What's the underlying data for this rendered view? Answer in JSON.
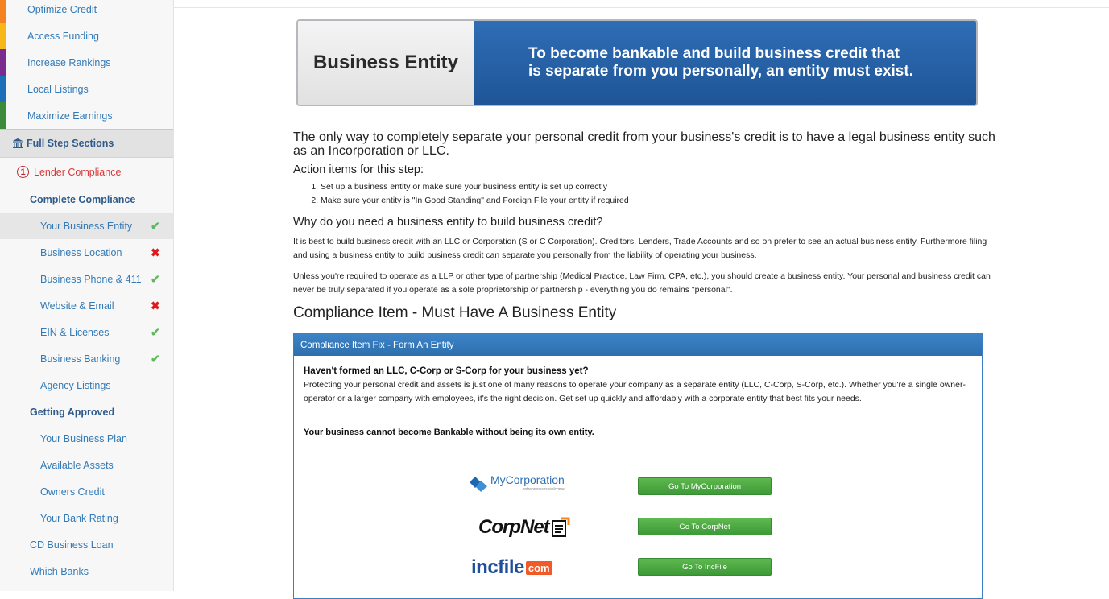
{
  "sidebar": {
    "top_items": [
      {
        "label": "Optimize Credit",
        "color": "#f58220"
      },
      {
        "label": "Access Funding",
        "color": "#f7b718"
      },
      {
        "label": "Increase Rankings",
        "color": "#7a2c8f"
      },
      {
        "label": "Local Listings",
        "color": "#1c6fb8"
      },
      {
        "label": "Maximize Earnings",
        "color": "#3b8b3b"
      }
    ],
    "section_title": "Full Step Sections",
    "lender": {
      "number": "1",
      "label": "Lender Compliance"
    },
    "complete_heading": "Complete Compliance",
    "complete_items": [
      {
        "label": "Your Business Entity",
        "status": "✔"
      },
      {
        "label": "Business Location",
        "status": "✖"
      },
      {
        "label": "Business Phone & 411",
        "status": "✔"
      },
      {
        "label": "Website & Email",
        "status": "✖"
      },
      {
        "label": "EIN & Licenses",
        "status": "✔"
      },
      {
        "label": "Business Banking",
        "status": "✔"
      },
      {
        "label": "Agency Listings"
      }
    ],
    "approved_heading": "Getting Approved",
    "approved_items": [
      {
        "label": "Your Business Plan"
      },
      {
        "label": "Available Assets"
      },
      {
        "label": "Owners Credit"
      },
      {
        "label": "Your Bank Rating"
      }
    ],
    "bottom_items": [
      {
        "label": "CD Business Loan"
      },
      {
        "label": "Which Banks"
      }
    ]
  },
  "banner": {
    "title": "Business Entity",
    "line1": "To become bankable and build business credit that",
    "line2": "is separate from you personally, an entity must exist."
  },
  "content": {
    "lead": "The only way to completely separate your personal credit from your business's credit is to have a legal business entity such as an Incorporation or LLC.",
    "action_heading": "Action items for this step:",
    "actions": [
      "Set up a business entity or make sure your business entity is set up correctly",
      "Make sure your entity is \"In Good Standing\" and Foreign File your entity if required"
    ],
    "why_heading": "Why do you need a business entity to build business credit?",
    "para1": "It is best to build business credit with an LLC or Corporation (S or C Corporation).  Creditors, Lenders, Trade Accounts and so on prefer to see an actual business entity. Furthermore filing and using a business entity to build business credit can separate you personally from the liability of operating your business.",
    "para2": "Unless you're required to operate as a LLP or other type of partnership (Medical Practice, Law Firm, CPA, etc.), you should create a business entity. Your personal and business credit can never be truly separated if you operate as a sole proprietorship or partnership - everything you do remains \"personal\".",
    "compliance_heading": "Compliance Item - Must Have A Business Entity"
  },
  "panel": {
    "header": "Compliance Item Fix - Form An Entity",
    "question": "Haven't formed an LLC, C-Corp or S-Corp for your business yet?",
    "description": "Protecting your personal credit and assets is just one of many reasons to operate your company as a separate entity (LLC, C-Corp, S-Corp, etc.). Whether you're a single owner-operator or a larger company with employees, it's the right decision. Get set up quickly and affordably with a corporate entity that best fits your needs.",
    "bold_note": "Your business cannot become Bankable without being its own entity.",
    "providers": [
      {
        "logo": "MyCorporation",
        "tagline": "entrepreneurs welcome",
        "button": "Go To MyCorporation"
      },
      {
        "logo": "CorpNet",
        "button": "Go To CorpNet"
      },
      {
        "logo": "incfile",
        "logo_suffix": "com",
        "button": "Go To IncFile"
      }
    ]
  }
}
